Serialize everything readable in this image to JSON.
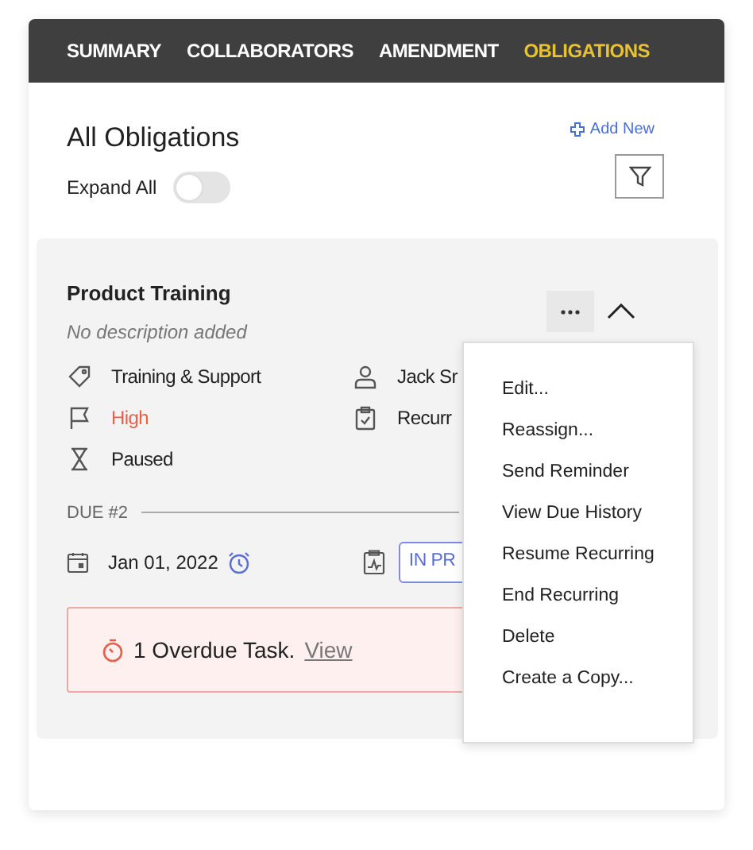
{
  "tabs": [
    {
      "label": "SUMMARY",
      "selected": false
    },
    {
      "label": "COLLABORATORS",
      "selected": false
    },
    {
      "label": "AMENDMENT",
      "selected": false
    },
    {
      "label": "OBLIGATIONS",
      "selected": true
    }
  ],
  "heading": "All Obligations",
  "add_new": "Add New",
  "expand_all": {
    "label": "Expand All",
    "on": false
  },
  "obligation": {
    "title": "Product Training",
    "description": "No description added",
    "details": [
      {
        "kind": "tag",
        "text": "Training & Support"
      },
      {
        "kind": "person",
        "text": "Jack Sr"
      },
      {
        "kind": "flag",
        "text": "High",
        "color": "#e8604c"
      },
      {
        "kind": "clipboard",
        "text": "Recurr"
      },
      {
        "kind": "hourglass",
        "text": "Paused"
      }
    ],
    "due_label": "DUE #2",
    "due_date": "Jan 01, 2022",
    "status": "IN PR",
    "overdue": {
      "text": "1 Overdue Task.",
      "link": "View"
    }
  },
  "menu": [
    "Edit...",
    "Reassign...",
    "Send Reminder",
    "View Due History",
    "Resume Recurring",
    "End Recurring",
    "Delete",
    "Create a Copy..."
  ]
}
